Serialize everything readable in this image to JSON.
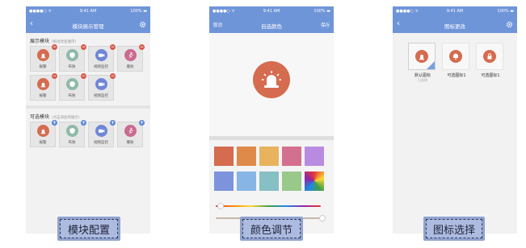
{
  "status_bar": {
    "carrier": "●●●●○ ᯤ",
    "time": "9:41 AM",
    "battery": "100% ▬"
  },
  "screen1": {
    "nav_title": "模块展示管理",
    "shown_section": {
      "title": "展示模块",
      "hint": "（拖动改变顺序）"
    },
    "shown_tiles": [
      {
        "label": "报警",
        "icon": "alarm-icon",
        "color": "#d56b4f"
      },
      {
        "label": "布防",
        "icon": "shield-icon",
        "color": "#8fb9a8"
      },
      {
        "label": "视频监控",
        "icon": "camera-icon",
        "color": "#6f86d6"
      },
      {
        "label": "撤防",
        "icon": "run-icon",
        "color": "#c96a8f"
      },
      {
        "label": "报警",
        "icon": "alarm-icon",
        "color": "#d56b4f"
      },
      {
        "label": "布防",
        "icon": "shield-icon",
        "color": "#8fb9a8"
      },
      {
        "label": "视频监控",
        "icon": "camera-icon",
        "color": "#6f86d6"
      }
    ],
    "optional_section": {
      "title": "可选模块",
      "hint": "（点击添加到展示）"
    },
    "optional_tiles": [
      {
        "label": "报警",
        "icon": "alarm-icon",
        "color": "#d56b4f"
      },
      {
        "label": "布防",
        "icon": "shield-icon",
        "color": "#8fb9a8"
      },
      {
        "label": "视频监控",
        "icon": "camera-icon",
        "color": "#6f86d6"
      },
      {
        "label": "撤防",
        "icon": "run-icon",
        "color": "#c96a8f"
      }
    ]
  },
  "screen2": {
    "nav_left": "取消",
    "nav_title": "自选颜色",
    "nav_right": "保存",
    "preview_color": "#d56b4f",
    "swatches": [
      "#d56b4f",
      "#e08a4a",
      "#e8b25e",
      "#d4708f",
      "#b98be0",
      "#7d93dc",
      "#86b5e6",
      "#86bfc4",
      "#98c98a",
      "rainbow"
    ]
  },
  "screen3": {
    "nav_title": "图标更改",
    "options": [
      {
        "name": "默认图标",
        "sub": "已选择",
        "selected": true
      },
      {
        "name": "可选图标1",
        "sub": "",
        "selected": false
      },
      {
        "name": "可选图标1",
        "sub": "",
        "selected": false
      }
    ]
  },
  "captions": {
    "c1": "模块配置",
    "c2": "颜色调节",
    "c3": "图标选择"
  }
}
